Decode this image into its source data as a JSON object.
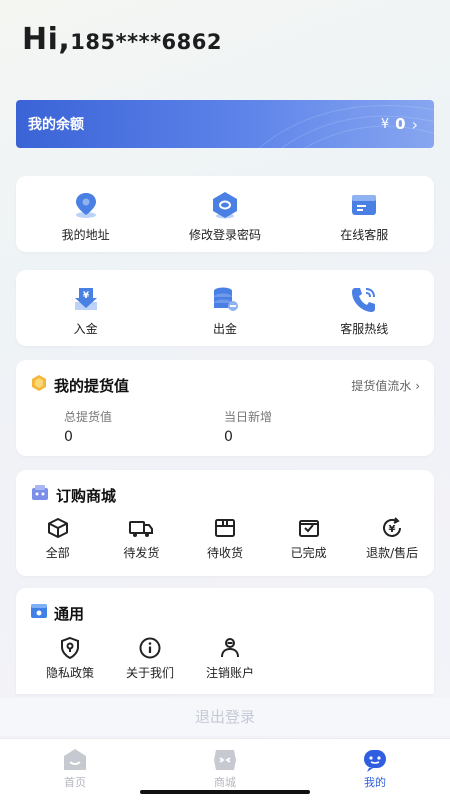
{
  "greeting": {
    "hi": "Hi,",
    "phone": "185****6862"
  },
  "balance": {
    "title": "我的余额",
    "currency": "¥",
    "amount": "0",
    "chevron": "›"
  },
  "quick_actions": [
    {
      "label": "我的地址",
      "icon": "location-pin-icon"
    },
    {
      "label": "修改登录密码",
      "icon": "hexagon-lock-icon"
    },
    {
      "label": "在线客服",
      "icon": "customer-service-card-icon"
    }
  ],
  "funds": [
    {
      "label": "入金",
      "icon": "deposit-icon"
    },
    {
      "label": "出金",
      "icon": "withdraw-coins-icon"
    },
    {
      "label": "客服热线",
      "icon": "phone-hotline-icon"
    }
  ],
  "pickup": {
    "title": "我的提货值",
    "link": "提货值流水",
    "stats": [
      {
        "label": "总提货值",
        "value": "0"
      },
      {
        "label": "当日新增",
        "value": "0"
      }
    ]
  },
  "orders": {
    "title": "订购商城",
    "items": [
      {
        "label": "全部",
        "icon": "box-icon"
      },
      {
        "label": "待发货",
        "icon": "truck-icon"
      },
      {
        "label": "待收货",
        "icon": "package-icon"
      },
      {
        "label": "已完成",
        "icon": "completed-box-icon"
      },
      {
        "label": "退款/售后",
        "icon": "refund-icon"
      }
    ]
  },
  "general": {
    "title": "通用",
    "items": [
      {
        "label": "隐私政策",
        "icon": "shield-icon"
      },
      {
        "label": "关于我们",
        "icon": "info-icon"
      },
      {
        "label": "注销账户",
        "icon": "user-remove-icon"
      }
    ]
  },
  "logout": "退出登录",
  "tabs": [
    {
      "label": "首页",
      "icon": "home-icon",
      "active": false
    },
    {
      "label": "商城",
      "icon": "shop-icon",
      "active": false
    },
    {
      "label": "我的",
      "icon": "profile-icon",
      "active": true
    }
  ],
  "colors": {
    "accent": "#3a63d6",
    "tab_inactive": "#b5b8c0",
    "tab_active": "#2f5fe0"
  }
}
